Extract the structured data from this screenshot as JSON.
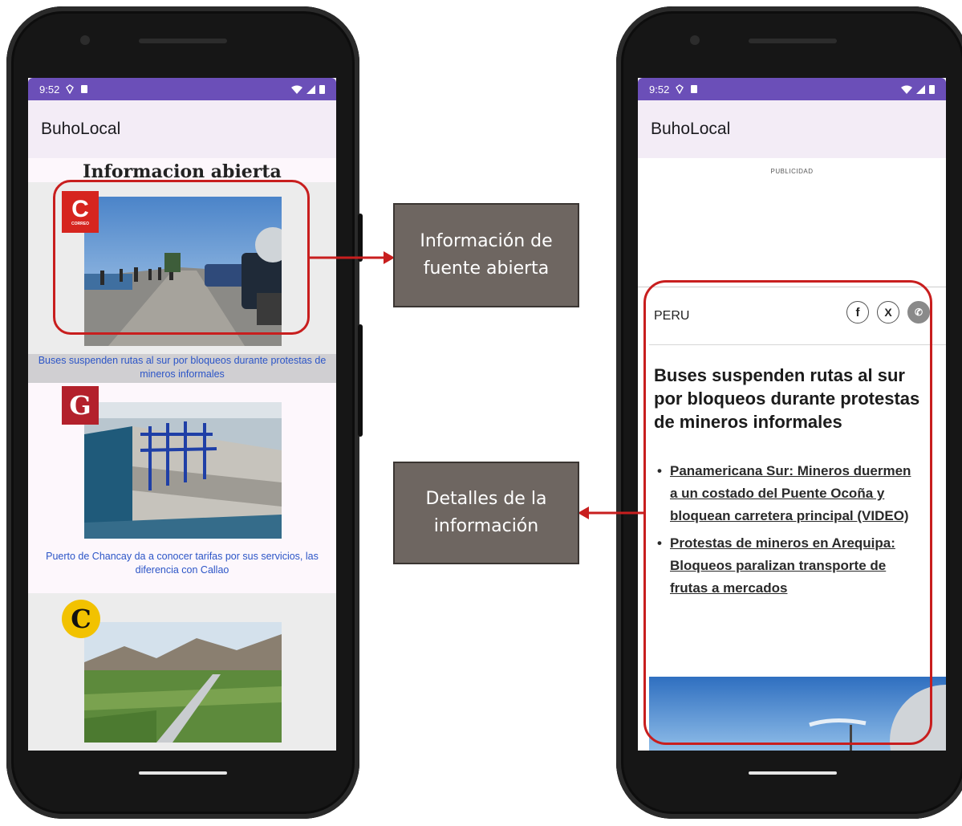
{
  "left_phone": {
    "status": {
      "time": "9:52"
    },
    "app_title": "BuhoLocal",
    "page_heading": "Informacion abierta",
    "articles": [
      {
        "source_logo": "C",
        "source_logo_sub": "CORREO",
        "caption": "Buses suspenden rutas al sur por bloqueos durante protestas de mineros informales"
      },
      {
        "source_logo": "G",
        "caption": "Puerto de Chancay da a conocer tarifas por sus servicios, las diferencia con Callao"
      },
      {
        "source_logo": "C",
        "caption": ""
      }
    ]
  },
  "right_phone": {
    "status": {
      "time": "9:52"
    },
    "app_title": "BuhoLocal",
    "ad_label": "PUBLICIDAD",
    "section": "PERU",
    "share_icons": [
      "facebook-icon",
      "x-icon",
      "whatsapp-icon"
    ],
    "headline": "Buses suspenden rutas al sur por bloqueos durante protestas de mineros informales",
    "related_links": [
      "Panamericana Sur: Mineros duermen a un costado del Puente Ocoña y bloquean carretera principal (VIDEO)",
      "Protestas de mineros en Arequipa: Bloqueos paralizan transporte de frutas a mercados"
    ]
  },
  "callouts": {
    "open_source": "Información de fuente abierta",
    "details": "Detalles de la información"
  },
  "colors": {
    "status_bar": "#6b4fb8",
    "app_bar": "#f3ecf6",
    "highlight": "#c81e1e",
    "callout_bg": "#6e6661",
    "caption_link": "#2c55c7"
  }
}
